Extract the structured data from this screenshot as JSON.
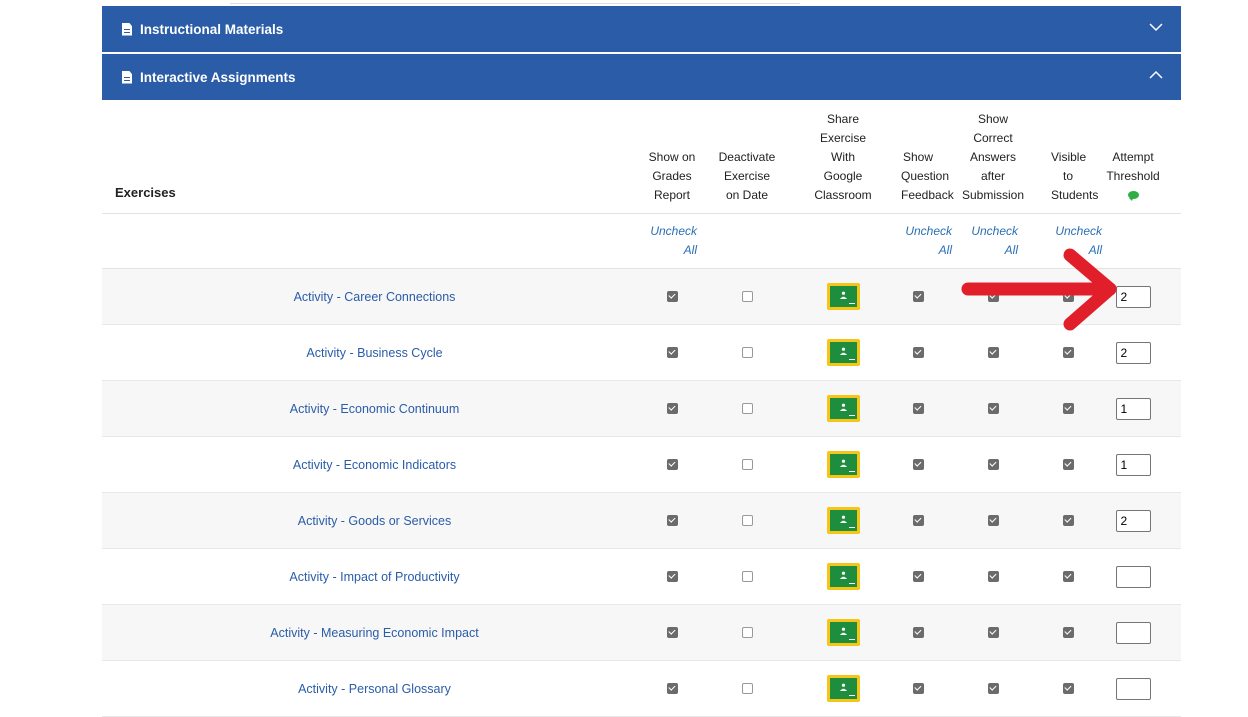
{
  "panels": [
    {
      "title": "Instructional Materials",
      "expanded": false
    },
    {
      "title": "Interactive Assignments",
      "expanded": true
    }
  ],
  "columns": {
    "exercises": "Exercises",
    "grades": "Show on\nGrades\nReport",
    "deactivate": "Deactivate\nExercise\non Date",
    "share": "Share\nExercise\nWith\nGoogle\nClassroom",
    "feedback": "Show\nQuestion\nFeedback",
    "correct": "Show\nCorrect\nAnswers\nafter\nSubmission",
    "visible": "Visible to\nStudents",
    "threshold": "Attempt\nThreshold"
  },
  "uncheck_all": "Uncheck\nAll",
  "rows": [
    {
      "name": "Activity - Career Connections",
      "grades": true,
      "deactivate": false,
      "feedback": true,
      "correct": true,
      "visible": true,
      "threshold": "2"
    },
    {
      "name": "Activity - Business Cycle",
      "grades": true,
      "deactivate": false,
      "feedback": true,
      "correct": true,
      "visible": true,
      "threshold": "2"
    },
    {
      "name": "Activity - Economic Continuum",
      "grades": true,
      "deactivate": false,
      "feedback": true,
      "correct": true,
      "visible": true,
      "threshold": "1"
    },
    {
      "name": "Activity - Economic Indicators",
      "grades": true,
      "deactivate": false,
      "feedback": true,
      "correct": true,
      "visible": true,
      "threshold": "1"
    },
    {
      "name": "Activity - Goods or Services",
      "grades": true,
      "deactivate": false,
      "feedback": true,
      "correct": true,
      "visible": true,
      "threshold": "2"
    },
    {
      "name": "Activity - Impact of Productivity",
      "grades": true,
      "deactivate": false,
      "feedback": true,
      "correct": true,
      "visible": true,
      "threshold": ""
    },
    {
      "name": "Activity - Measuring Economic Impact",
      "grades": true,
      "deactivate": false,
      "feedback": true,
      "correct": true,
      "visible": true,
      "threshold": ""
    },
    {
      "name": "Activity - Personal Glossary",
      "grades": true,
      "deactivate": false,
      "feedback": true,
      "correct": true,
      "visible": true,
      "threshold": ""
    }
  ],
  "colors": {
    "panel": "#2a5ca8",
    "arrow": "#e01f2b",
    "link": "#2a5ca8"
  },
  "icons": {
    "panel": "document-icon",
    "classroom": "google-classroom-icon",
    "comment": "comment-icon"
  }
}
